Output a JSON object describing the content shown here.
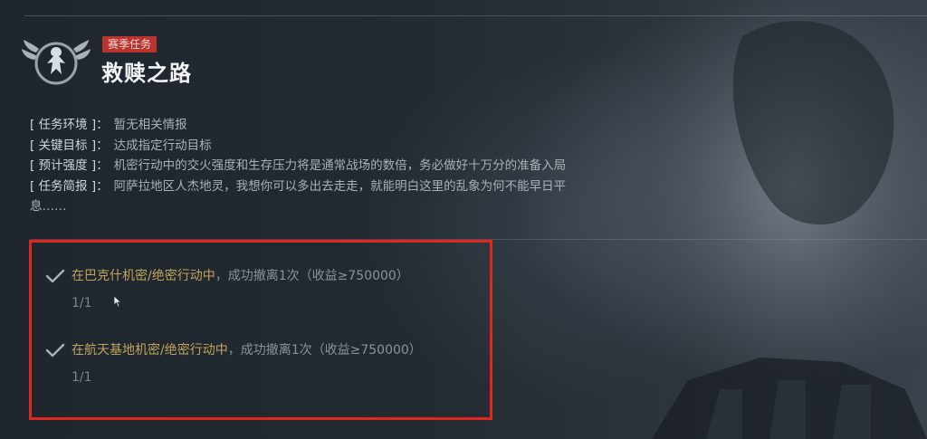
{
  "mission": {
    "tag": "赛季任务",
    "title": "救赎之路"
  },
  "briefing": [
    {
      "label": "[ 任务环境 ]：",
      "value": "暂无相关情报"
    },
    {
      "label": "[ 关键目标 ]：",
      "value": "达成指定行动目标"
    },
    {
      "label": "[ 预计强度 ]：",
      "value": "机密行动中的交火强度和生存压力将是通常战场的数倍，务必做好十万分的准备入局"
    },
    {
      "label": "[ 任务简报 ]：",
      "value": "阿萨拉地区人杰地灵，我想你可以多出去走走，就能明白这里的乱象为何不能早日平",
      "continuation": "息……"
    }
  ],
  "objectives": [
    {
      "location": "在巴克什机密/绝密行动中",
      "detail": "，成功撤离1次（收益≥750000）",
      "progress": "1/1",
      "completed": true
    },
    {
      "location": "在航天基地机密/绝密行动中",
      "detail": "，成功撤离1次（收益≥750000）",
      "progress": "1/1",
      "completed": true
    }
  ],
  "colors": {
    "tag_bg": "#b8352f",
    "location_text": "#bfa55e",
    "highlight_border": "#e0261f"
  },
  "icons": {
    "emblem": "eagle-wings-emblem-icon",
    "check": "checkmark-icon"
  }
}
